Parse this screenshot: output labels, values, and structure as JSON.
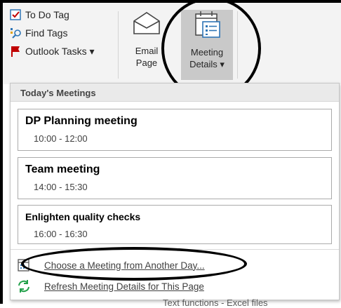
{
  "ribbon": {
    "tags": [
      {
        "label": "To Do Tag",
        "icon": "checkbox-icon"
      },
      {
        "label": "Find Tags",
        "icon": "find-tags-icon"
      },
      {
        "label": "Outlook Tasks ▾",
        "icon": "flag-icon"
      }
    ],
    "email_page": {
      "line1": "Email",
      "line2": "Page"
    },
    "meeting_details": {
      "line1": "Meeting",
      "line2": "Details ▾"
    }
  },
  "dropdown": {
    "header": "Today's Meetings",
    "meetings": [
      {
        "title": "DP Planning meeting",
        "time": "10:00 - 12:00"
      },
      {
        "title": "Team meeting",
        "time": "14:00 - 15:30"
      },
      {
        "title": "Enlighten quality checks",
        "time": "16:00 - 16:30"
      }
    ],
    "choose_another_day": "Choose a Meeting from Another Day...",
    "refresh": "Refresh Meeting Details for This Page"
  },
  "background_peek": {
    "bottom_text": "Text functions - Excel files"
  },
  "colors": {
    "accent_blue": "#2e75b6",
    "flag_red": "#c00000",
    "refresh_green": "#22a04a",
    "annotation_black": "#000000"
  }
}
